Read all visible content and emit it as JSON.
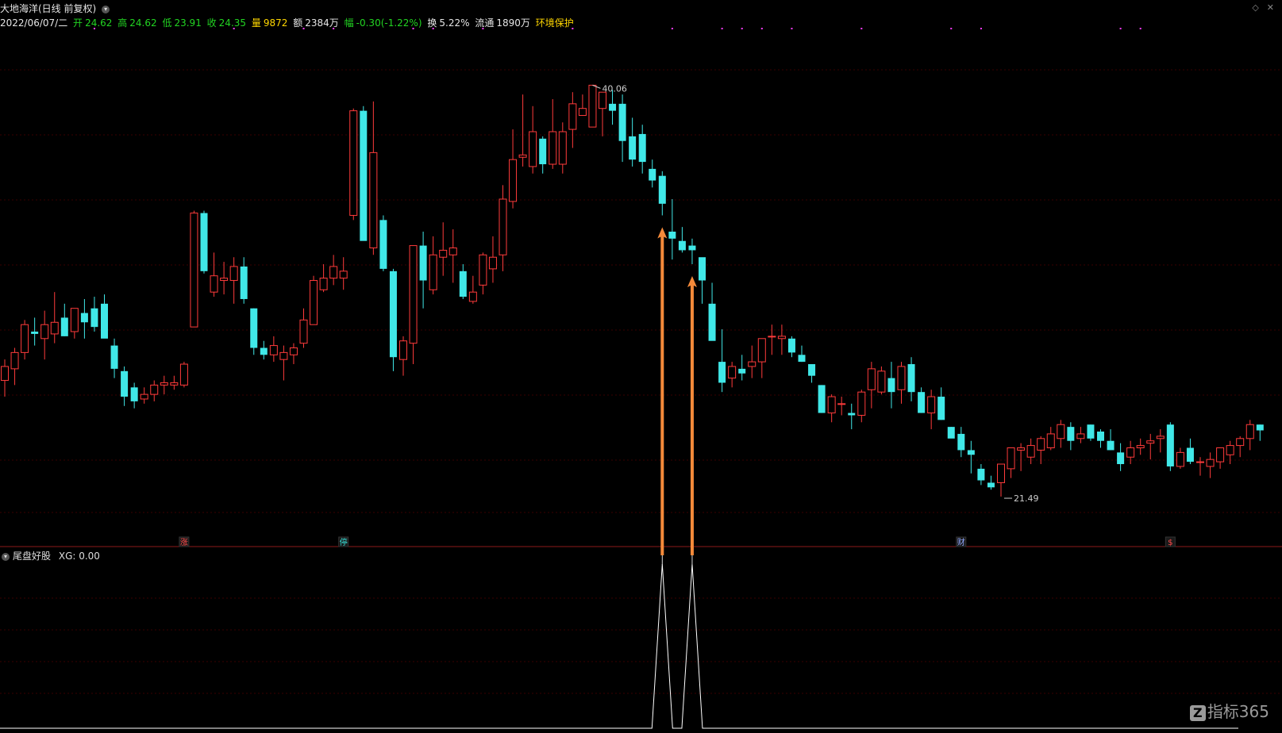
{
  "header": {
    "stock_title": "大地海洋(日线 前复权)",
    "date": "2022/06/07/二",
    "open_label": "开",
    "open": "24.62",
    "high_label": "高",
    "high": "24.62",
    "low_label": "低",
    "low": "23.91",
    "close_label": "收",
    "close": "24.35",
    "vol_label": "量",
    "vol": "9872",
    "amount_label": "额",
    "amount": "2384万",
    "change_label": "幅",
    "change": "-0.30(-1.22%)",
    "turnover_label": "换",
    "turnover": "5.22%",
    "float_label": "流通",
    "float": "1890万",
    "tag": "环境保护"
  },
  "indicator": {
    "name": "尾盘好股",
    "value_text": "XG: 0.00"
  },
  "annotations": {
    "high_label": "40.06",
    "low_label": "21.49",
    "markers": [
      {
        "text": "涨",
        "index": 18,
        "color": "#ff4a4a"
      },
      {
        "text": "停",
        "index": 34,
        "color": "#38e8e0"
      },
      {
        "text": "财",
        "index": 96,
        "color": "#8fa8ff"
      },
      {
        "text": "$",
        "index": 117,
        "color": "#ff4a4a"
      }
    ]
  },
  "logo_text": "指标365",
  "colors": {
    "up": "#ff3b3b",
    "down": "#40e8e8",
    "arrow": "#f58a3a",
    "signal": "#ffffff",
    "grid": "#3a0000"
  },
  "chart_data": {
    "type": "candlestick",
    "y_range": [
      20.0,
      41.5
    ],
    "ohlc": [
      [
        26.5,
        27.4,
        25.8,
        27.1
      ],
      [
        27.0,
        27.9,
        26.3,
        27.7
      ],
      [
        27.7,
        29.1,
        27.4,
        28.9
      ],
      [
        28.6,
        29.2,
        28.0,
        28.5
      ],
      [
        28.3,
        29.5,
        27.4,
        28.9
      ],
      [
        28.5,
        30.3,
        28.1,
        29.0
      ],
      [
        29.2,
        29.8,
        28.4,
        28.4
      ],
      [
        28.6,
        29.6,
        28.3,
        29.6
      ],
      [
        29.4,
        30.0,
        28.3,
        29.0
      ],
      [
        29.6,
        30.1,
        28.6,
        28.8
      ],
      [
        29.8,
        30.2,
        28.5,
        28.3
      ],
      [
        28.0,
        28.3,
        26.6,
        27.0
      ],
      [
        26.9,
        27.1,
        25.4,
        25.8
      ],
      [
        26.2,
        26.4,
        25.3,
        25.6
      ],
      [
        25.7,
        26.2,
        25.5,
        25.9
      ],
      [
        25.9,
        26.5,
        25.6,
        26.3
      ],
      [
        26.3,
        26.7,
        25.9,
        26.4
      ],
      [
        26.3,
        26.7,
        26.1,
        26.4
      ],
      [
        26.3,
        27.3,
        26.2,
        27.2
      ],
      [
        28.8,
        33.8,
        28.8,
        33.7
      ],
      [
        33.7,
        33.8,
        31.1,
        31.2
      ],
      [
        30.3,
        32.0,
        30.1,
        31.0
      ],
      [
        30.8,
        31.6,
        30.2,
        30.9
      ],
      [
        30.8,
        31.8,
        29.8,
        31.4
      ],
      [
        31.4,
        31.8,
        29.8,
        30.0
      ],
      [
        29.6,
        29.6,
        27.6,
        27.9
      ],
      [
        27.9,
        28.2,
        27.4,
        27.6
      ],
      [
        27.6,
        28.4,
        27.3,
        28.0
      ],
      [
        27.4,
        28.0,
        26.5,
        27.7
      ],
      [
        27.6,
        28.1,
        27.2,
        27.9
      ],
      [
        28.1,
        29.6,
        27.9,
        29.1
      ],
      [
        28.9,
        31.0,
        28.9,
        30.8
      ],
      [
        30.4,
        31.5,
        30.3,
        30.9
      ],
      [
        30.9,
        31.9,
        30.6,
        31.4
      ],
      [
        30.9,
        31.8,
        30.4,
        31.2
      ],
      [
        33.6,
        38.2,
        33.4,
        38.1
      ],
      [
        38.1,
        38.3,
        33.4,
        32.5
      ],
      [
        32.2,
        38.5,
        31.9,
        36.3
      ],
      [
        33.4,
        33.6,
        31.2,
        31.3
      ],
      [
        31.2,
        31.3,
        26.9,
        27.5
      ],
      [
        27.4,
        28.4,
        26.7,
        28.2
      ],
      [
        28.1,
        32.0,
        27.2,
        32.3
      ],
      [
        32.3,
        32.9,
        29.6,
        30.8
      ],
      [
        30.4,
        32.7,
        30.2,
        31.9
      ],
      [
        31.8,
        33.3,
        31.0,
        32.1
      ],
      [
        31.9,
        33.0,
        30.7,
        32.2
      ],
      [
        31.2,
        31.5,
        30.0,
        30.1
      ],
      [
        29.9,
        31.0,
        29.8,
        30.3
      ],
      [
        30.6,
        32.0,
        30.2,
        31.9
      ],
      [
        31.3,
        32.7,
        30.7,
        31.8
      ],
      [
        31.9,
        34.9,
        31.2,
        34.3
      ],
      [
        34.2,
        37.3,
        33.9,
        36.0
      ],
      [
        36.1,
        38.8,
        35.7,
        36.2
      ],
      [
        35.7,
        38.3,
        35.4,
        37.2
      ],
      [
        36.9,
        37.0,
        35.4,
        35.8
      ],
      [
        35.8,
        38.6,
        35.6,
        37.2
      ],
      [
        35.8,
        37.6,
        35.4,
        37.2
      ],
      [
        37.3,
        38.9,
        36.5,
        38.4
      ],
      [
        37.9,
        38.8,
        37.9,
        38.2
      ],
      [
        37.4,
        39.2,
        37.4,
        39.2
      ],
      [
        38.2,
        38.9,
        37.0,
        38.9
      ],
      [
        38.4,
        39.0,
        37.5,
        38.1
      ],
      [
        38.4,
        38.8,
        35.9,
        36.8
      ],
      [
        37.0,
        37.8,
        35.7,
        36.0
      ],
      [
        37.1,
        37.5,
        35.4,
        35.9
      ],
      [
        35.6,
        36.0,
        34.8,
        35.1
      ],
      [
        35.3,
        35.5,
        33.6,
        34.1
      ],
      [
        32.9,
        34.3,
        31.7,
        32.6
      ],
      [
        32.5,
        33.1,
        32.0,
        32.1
      ],
      [
        32.3,
        32.6,
        31.5,
        32.1
      ],
      [
        31.8,
        31.7,
        29.8,
        30.8
      ],
      [
        29.8,
        30.7,
        28.5,
        28.2
      ],
      [
        27.3,
        28.7,
        26.0,
        26.4
      ],
      [
        26.6,
        27.3,
        26.2,
        27.1
      ],
      [
        27.0,
        27.6,
        26.5,
        26.8
      ],
      [
        27.1,
        28.0,
        26.6,
        27.3
      ],
      [
        27.3,
        28.2,
        26.6,
        28.3
      ],
      [
        28.4,
        28.9,
        27.6,
        28.4
      ],
      [
        28.3,
        28.9,
        27.6,
        28.4
      ],
      [
        28.3,
        28.4,
        27.5,
        27.7
      ],
      [
        27.6,
        28.0,
        27.3,
        27.3
      ],
      [
        27.2,
        27.0,
        26.4,
        26.7
      ],
      [
        26.3,
        26.3,
        25.1,
        25.1
      ],
      [
        25.1,
        25.9,
        24.7,
        25.8
      ],
      [
        25.5,
        25.8,
        25.0,
        25.5
      ],
      [
        25.1,
        25.5,
        24.4,
        25.0
      ],
      [
        25.0,
        26.1,
        24.7,
        26.0
      ],
      [
        26.1,
        27.3,
        25.3,
        27.0
      ],
      [
        26.0,
        27.1,
        25.9,
        26.9
      ],
      [
        26.6,
        27.3,
        25.3,
        26.0
      ],
      [
        26.1,
        27.3,
        25.5,
        27.1
      ],
      [
        27.2,
        27.5,
        25.6,
        26.0
      ],
      [
        26.0,
        26.2,
        25.1,
        25.1
      ],
      [
        25.1,
        26.1,
        24.4,
        25.8
      ],
      [
        25.8,
        26.2,
        24.8,
        24.8
      ],
      [
        24.5,
        24.5,
        24.4,
        24.0
      ],
      [
        24.2,
        24.5,
        23.2,
        23.5
      ],
      [
        23.5,
        23.9,
        22.5,
        23.3
      ],
      [
        22.7,
        22.9,
        22.0,
        22.2
      ],
      [
        22.1,
        22.4,
        21.8,
        21.9
      ],
      [
        22.1,
        22.7,
        21.5,
        22.9
      ],
      [
        22.7,
        23.2,
        22.3,
        23.6
      ],
      [
        23.5,
        23.8,
        22.6,
        23.6
      ],
      [
        23.2,
        24.0,
        22.9,
        23.7
      ],
      [
        23.5,
        24.1,
        22.9,
        24.0
      ],
      [
        23.6,
        24.5,
        23.5,
        24.2
      ],
      [
        24.0,
        24.8,
        23.6,
        24.6
      ],
      [
        24.5,
        24.7,
        23.5,
        23.9
      ],
      [
        24.0,
        24.5,
        23.8,
        24.2
      ],
      [
        24.6,
        24.6,
        23.9,
        24.0
      ],
      [
        24.3,
        24.4,
        23.6,
        23.9
      ],
      [
        23.9,
        24.4,
        23.5,
        23.5
      ],
      [
        23.4,
        23.8,
        22.6,
        22.9
      ],
      [
        23.2,
        23.9,
        22.9,
        23.6
      ],
      [
        23.6,
        24.0,
        23.3,
        23.7
      ],
      [
        23.8,
        24.2,
        23.1,
        23.9
      ],
      [
        24.0,
        24.4,
        23.4,
        24.1
      ],
      [
        24.6,
        24.7,
        22.6,
        22.8
      ],
      [
        22.8,
        23.6,
        22.7,
        23.4
      ],
      [
        23.6,
        24.0,
        22.9,
        23.0
      ],
      [
        23.0,
        23.2,
        22.4,
        23.0
      ],
      [
        22.8,
        23.4,
        22.3,
        23.1
      ],
      [
        23.0,
        23.6,
        22.7,
        23.6
      ],
      [
        23.3,
        23.9,
        22.9,
        23.7
      ],
      [
        23.7,
        24.1,
        23.2,
        24.0
      ],
      [
        24.0,
        24.8,
        23.5,
        24.6
      ],
      [
        24.6,
        24.6,
        23.9,
        24.35
      ]
    ],
    "signals": [
      66,
      69
    ],
    "signal_indicator": "XG"
  }
}
